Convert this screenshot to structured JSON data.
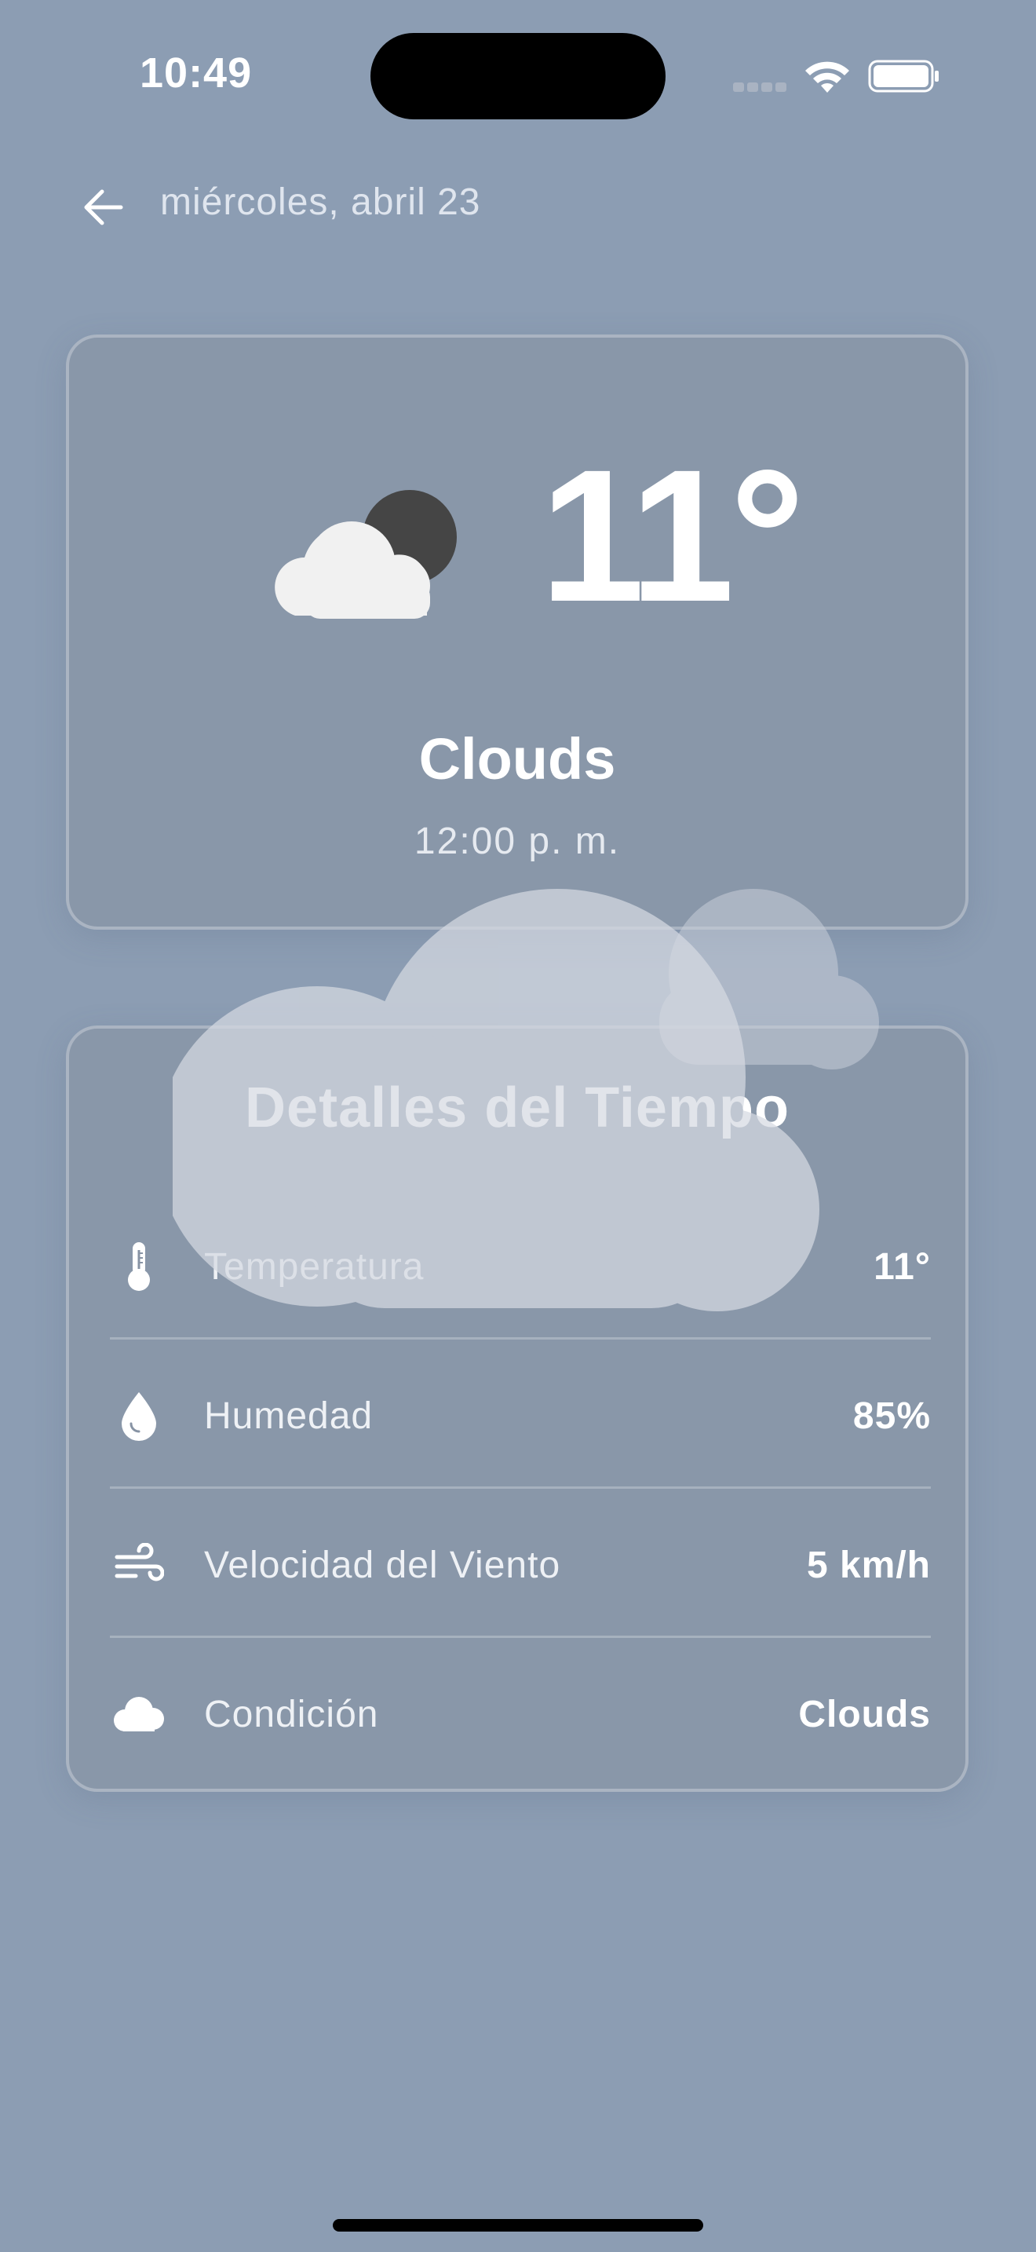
{
  "status_bar": {
    "time": "10:49",
    "icons": [
      "signal-icon",
      "wifi-icon",
      "battery-icon"
    ]
  },
  "header": {
    "back_icon": "arrow-left-icon",
    "date": "miércoles, abril 23"
  },
  "current": {
    "icon": "cloud-moon-icon",
    "temperature": "11°",
    "condition": "Clouds",
    "time": "12:00 p. m."
  },
  "details": {
    "title": "Detalles del Tiempo",
    "rows": [
      {
        "icon": "thermometer-icon",
        "label": "Temperatura",
        "value": "11°"
      },
      {
        "icon": "droplet-icon",
        "label": "Humedad",
        "value": "85%"
      },
      {
        "icon": "wind-icon",
        "label": "Velocidad del Viento",
        "value": "5 km/h"
      },
      {
        "icon": "cloud-icon",
        "label": "Condición",
        "value": "Clouds"
      }
    ]
  },
  "colors": {
    "background": "#8c9db3",
    "card": "#8793a4",
    "text": "#ffffff"
  }
}
